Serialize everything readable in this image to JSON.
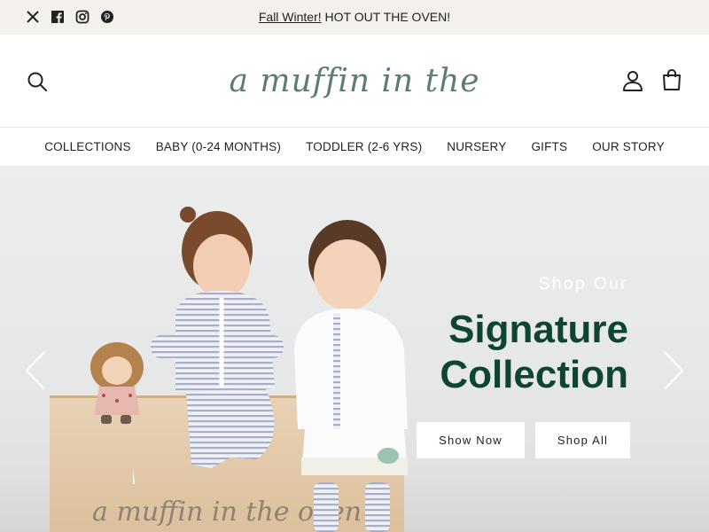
{
  "announcement": {
    "link_text": "Fall Winter!",
    "message": " HOT OUT THE OVEN!"
  },
  "social": [
    "x-icon",
    "facebook-icon",
    "instagram-icon",
    "pinterest-icon"
  ],
  "header": {
    "logo_text": "a muffin in the oven"
  },
  "nav": {
    "items": [
      "COLLECTIONS",
      "BABY (0-24 MONTHS)",
      "TODDLER (2-6 YRS)",
      "NURSERY",
      "GIFTS",
      "OUR STORY"
    ]
  },
  "hero": {
    "kicker": "Shop Our",
    "title": "Signature Collection",
    "crate_text": "a muffin in the oven",
    "buttons": {
      "primary": "Show Now",
      "secondary": "Shop All"
    }
  },
  "colors": {
    "announcement_bg": "#f4f0ec",
    "logo": "#5d7e6c",
    "hero_title": "#0d4532"
  }
}
